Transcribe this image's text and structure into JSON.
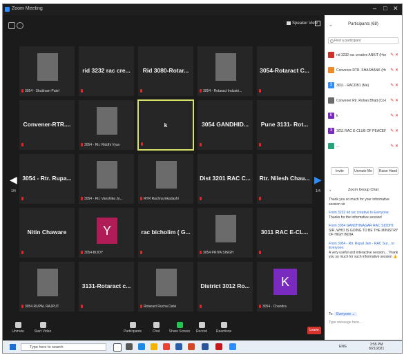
{
  "window": {
    "title": "Zoom Meeting"
  },
  "topbar": {
    "view_label": "Speaker View"
  },
  "tiles": [
    {
      "id": "r1c1",
      "big": "",
      "foot": "3054 - Shubham Patel",
      "has_photo": true
    },
    {
      "id": "r1c2",
      "big": "rid 3232 rac cre...",
      "foot": ""
    },
    {
      "id": "r1c3",
      "big": "Rid 3080-Rotar...",
      "foot": ""
    },
    {
      "id": "r1c4",
      "big": "",
      "foot": "3054 - Rotaract Industri...",
      "has_photo": true
    },
    {
      "id": "r1c5",
      "big": "3054-Rotaract C...",
      "foot": ""
    },
    {
      "id": "r2c1",
      "big": "Convener-RTR....",
      "foot": ""
    },
    {
      "id": "r2c2",
      "big": "",
      "foot": "3054 - Rtr. Riddhi Vyas",
      "has_photo": true
    },
    {
      "id": "r2c3",
      "big": "k",
      "foot": "",
      "active": true
    },
    {
      "id": "r2c4",
      "big": "3054 GANDHID...",
      "foot": ""
    },
    {
      "id": "r2c5",
      "big": "Pune 3131- Rot...",
      "foot": ""
    },
    {
      "id": "r3c1",
      "big": "3054 - Rtr. Rupa...",
      "foot": ""
    },
    {
      "id": "r3c2",
      "big": "",
      "foot": "3054 - Rtr. Vanshika Jo...",
      "has_photo": true
    },
    {
      "id": "r3c3",
      "big": "",
      "foot": "RTR Rachna Ekadashi",
      "has_photo": true
    },
    {
      "id": "r3c4",
      "big": "Dist 3201 RAC C...",
      "foot": ""
    },
    {
      "id": "r3c5",
      "big": "Rtr. Nilesh Chau...",
      "foot": ""
    },
    {
      "id": "r4c1",
      "big": "Nitin Chaware",
      "foot": ""
    },
    {
      "id": "r4c2",
      "big": "",
      "foot": "3054-BIJOY",
      "avatar": "Y"
    },
    {
      "id": "r4c3",
      "big": "rac bicholim ( G...",
      "foot": ""
    },
    {
      "id": "r4c4",
      "big": "",
      "foot": "3054 PRIYA SINGH",
      "has_photo": true
    },
    {
      "id": "r4c5",
      "big": "3011 RAC E-CL...",
      "foot": ""
    },
    {
      "id": "r5c1",
      "big": "",
      "foot": "3054 RUPAL RAJPUT",
      "has_photo": true
    },
    {
      "id": "r5c2",
      "big": "3131-Rotaract c...",
      "foot": ""
    },
    {
      "id": "r5c3",
      "big": "",
      "foot": "Rotaract Rucha Dalvi",
      "has_photo": true
    },
    {
      "id": "r5c4",
      "big": "District 3012 Ro...",
      "foot": ""
    },
    {
      "id": "r5c5",
      "big": "",
      "foot": "3054 - Chandra",
      "avatar": "K"
    }
  ],
  "pager": {
    "left": "1/4",
    "right": "1/4"
  },
  "participants": {
    "header": "Participants (68)",
    "search_placeholder": "Find a participant",
    "items": [
      {
        "initial": "",
        "name": "rid 3232 rac creative ANKIT (Host)",
        "color": "#d0302b"
      },
      {
        "initial": "",
        "name": "Convener-RTR. SHASHANK (Host)",
        "color": "#f08a24"
      },
      {
        "initial": "3",
        "name": "3011 - RACDB1 (Me)",
        "color": "#2d8cff"
      },
      {
        "initial": "",
        "name": "Convener Rtr. Rohan Bhatt (Co-host)",
        "color": "#6b6b6b"
      },
      {
        "initial": "k",
        "name": "k",
        "color": "#7a2bbf"
      },
      {
        "initial": "3",
        "name": "3011 RAC E-CLUB OF PEACEFUL...",
        "color": "#7a2bbf"
      },
      {
        "initial": "",
        "name": "...",
        "color": "#23a57a"
      }
    ],
    "buttons": [
      "Invite",
      "Unmute Me",
      "Raise Hand"
    ]
  },
  "chat": {
    "header": "Zoom Group Chat",
    "messages": [
      {
        "from": "",
        "text": "Thank you so much for your informative session sir"
      },
      {
        "from": "From 3232 rid rac creative to Everyone:",
        "text": "Thanks for the informative session!"
      },
      {
        "from": "From 3054 GANDHINAGAR RAC SIDDHI:",
        "text": "SIR, WHO IS GOING TO BE THE MINISTRY OF HIGH INDIA"
      },
      {
        "from": "From 3054 - Rtr. Rupal Jain - RAC Sur... to Everyone:",
        "text": "A very useful and interactive session... Thank you so much for such informative session 👍"
      }
    ],
    "to_label": "To:",
    "to_value": "Everyone",
    "input_placeholder": "Type message here..."
  },
  "toolbar": {
    "items": [
      "Unmute",
      "Start Video",
      "Participants",
      "Chat",
      "Share Screen",
      "Record",
      "Reactions"
    ],
    "leave": "Leave"
  },
  "taskbar": {
    "search": "Type here to search",
    "tray": "ENG",
    "time": "3:55 PM",
    "date": "8/21/2021"
  }
}
